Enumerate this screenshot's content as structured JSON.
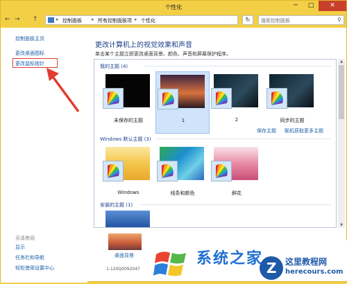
{
  "window": {
    "title": "个性化",
    "min_label": "─",
    "max_label": "□",
    "close_label": "✕"
  },
  "address": {
    "back": "←",
    "forward": "→",
    "up": "↑",
    "crumbs": [
      "控制面板",
      "所有控制面板项",
      "个性化"
    ],
    "separator": "▸",
    "refresh": "↻",
    "search_placeholder": "搜索控制面板"
  },
  "sidebar": {
    "links": [
      "控制面板主页",
      "更改桌面图标",
      "更改鼠标指针"
    ],
    "see_also": "另请参阅",
    "see_also_links": [
      "显示",
      "任务栏和导航",
      "轻松使用设置中心"
    ]
  },
  "main": {
    "heading": "更改计算机上的视觉效果和声音",
    "description": "单击某个主题立即更改桌面背景、颜色、声音和屏幕保护程序。",
    "my_themes": {
      "title": "我的主题 (4)",
      "items": [
        {
          "name": "未保存的主题"
        },
        {
          "name": "1"
        },
        {
          "name": "2"
        },
        {
          "name": "同步的主题"
        }
      ],
      "save_link": "保存主题",
      "online_link": "联机获取更多主题"
    },
    "windows_themes": {
      "title": "Windows 默认主题 (3)",
      "items": [
        {
          "name": "Windows"
        },
        {
          "name": "线条和颜色"
        },
        {
          "name": "鲜花"
        }
      ]
    },
    "installed_themes": {
      "title": "安装的主题 (1)"
    }
  },
  "bottom": {
    "background_label": "桌面背景",
    "background_sub": "1-120Q0092047"
  },
  "watermark": {
    "site_cn": "系统之家",
    "site2_cn": "这里教程网",
    "site2_url": "herecours.com"
  },
  "colors": {
    "titlebar": "#f2cf45",
    "link": "#1a5ea8",
    "heading": "#1a3f8a",
    "selected": "#cfe3fb",
    "annotation": "#e23b2f"
  }
}
